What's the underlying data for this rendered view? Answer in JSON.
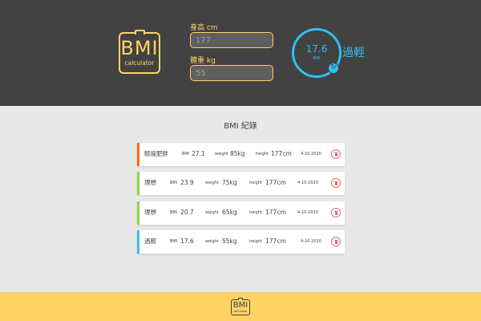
{
  "header": {
    "logo": {
      "big": "BMI",
      "small": "calculator"
    },
    "height_field": {
      "label": "身高 cm",
      "value": "177"
    },
    "weight_field": {
      "label": "體重 kg",
      "value": "55"
    },
    "result": {
      "value": "17.6",
      "unit": "BMI",
      "status": "過輕",
      "reset_icon": "refresh-icon",
      "color": "#31bff3"
    }
  },
  "records": {
    "title": "BMI 紀錄",
    "items": [
      {
        "status": "輕度肥胖",
        "bmi_label": "BMI",
        "bmi": "27.1",
        "weight_label": "weight",
        "weight": "85kg",
        "height_label": "height",
        "height": "177cm",
        "date": "4-10-2020",
        "color": "#ff6c02"
      },
      {
        "status": "理想",
        "bmi_label": "BMI",
        "bmi": "23.9",
        "weight_label": "weight",
        "weight": "75kg",
        "height_label": "height",
        "height": "177cm",
        "date": "4-10-2020",
        "color": "#86d73f"
      },
      {
        "status": "理想",
        "bmi_label": "BMI",
        "bmi": "20.7",
        "weight_label": "weight",
        "weight": "65kg",
        "height_label": "height",
        "height": "177cm",
        "date": "4-10-2020",
        "color": "#86d73f"
      },
      {
        "status": "過輕",
        "bmi_label": "BMI",
        "bmi": "17.6",
        "weight_label": "weight",
        "weight": "55kg",
        "height_label": "height",
        "height": "177cm",
        "date": "4-10-2020",
        "color": "#31bff3"
      }
    ],
    "delete_icon": "trash-icon"
  },
  "footer": {
    "logo": {
      "big": "BMI",
      "small": "calculator"
    }
  },
  "colors": {
    "header_bg": "#424242",
    "accent": "#ffd366",
    "body_bg": "#e8e8e8",
    "delete": "#e46d6d"
  }
}
